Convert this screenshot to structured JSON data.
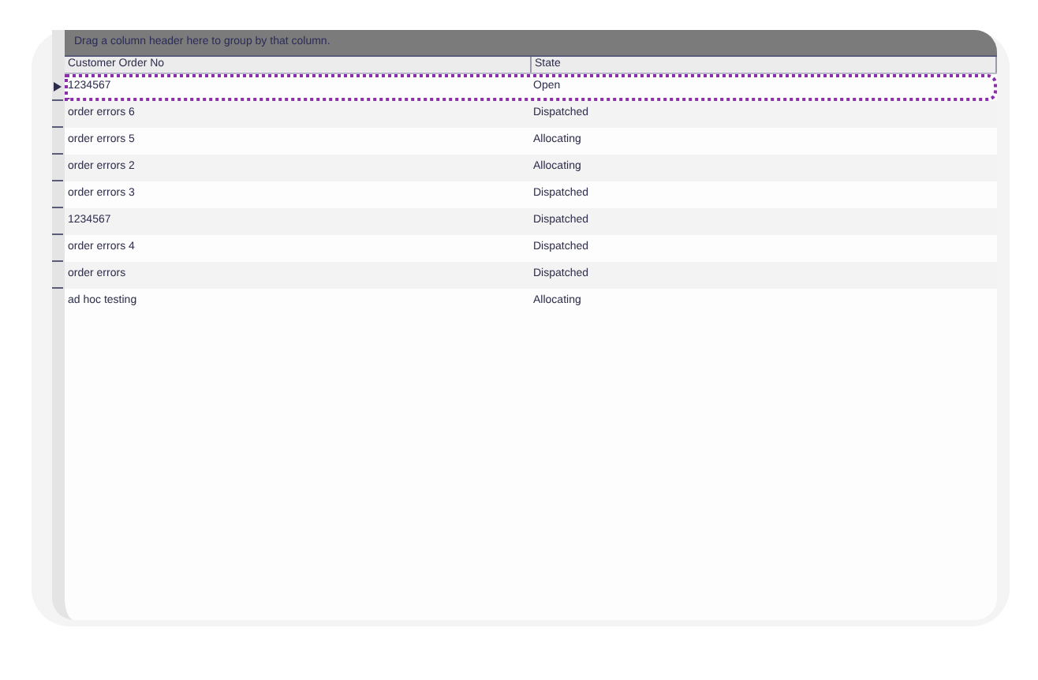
{
  "group_panel": {
    "hint": "Drag a column header here to group by that column."
  },
  "table": {
    "columns": [
      "Customer Order No",
      "State"
    ],
    "rows": [
      {
        "cells": [
          "1234567",
          "Open"
        ],
        "selected": true
      },
      {
        "cells": [
          "order errors 6",
          "Dispatched"
        ],
        "selected": false
      },
      {
        "cells": [
          "order errors 5",
          "Allocating"
        ],
        "selected": false
      },
      {
        "cells": [
          "order errors 2",
          "Allocating"
        ],
        "selected": false
      },
      {
        "cells": [
          "order errors 3",
          "Dispatched"
        ],
        "selected": false
      },
      {
        "cells": [
          "1234567",
          "Dispatched"
        ],
        "selected": false
      },
      {
        "cells": [
          "order errors 4",
          "Dispatched"
        ],
        "selected": false
      },
      {
        "cells": [
          "order errors",
          "Dispatched"
        ],
        "selected": false
      },
      {
        "cells": [
          "ad hoc testing",
          "Allocating"
        ],
        "selected": false
      }
    ]
  }
}
